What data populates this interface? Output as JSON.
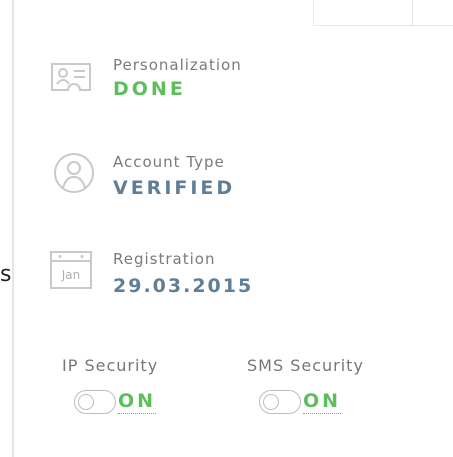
{
  "colors": {
    "done": "#5cbf5c",
    "value_blue": "#607f96",
    "label_gray": "#7a7a7a",
    "divider": "#e6e6e6"
  },
  "left_fragment": "s",
  "status": {
    "personalization": {
      "label": "Personalization",
      "value": "DONE",
      "icon": "id-card-icon"
    },
    "account_type": {
      "label": "Account Type",
      "value": "VERIFIED",
      "icon": "user-circle-icon"
    },
    "registration": {
      "label": "Registration",
      "value": "29.03.2015",
      "icon": "calendar-icon",
      "icon_text": "Jan"
    }
  },
  "security": {
    "ip": {
      "label": "IP Security",
      "state": "ON"
    },
    "sms": {
      "label": "SMS Security",
      "state": "ON"
    }
  }
}
